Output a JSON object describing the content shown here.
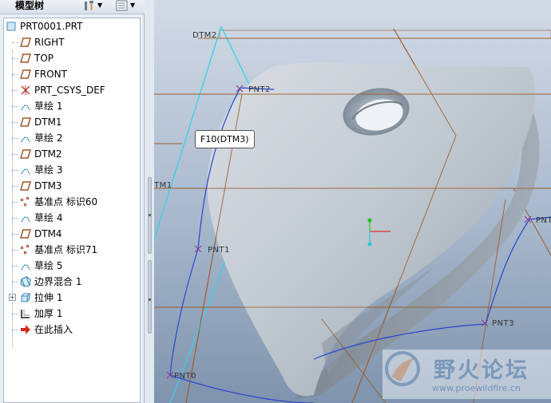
{
  "panel": {
    "title": "模型树"
  },
  "tree": {
    "root": "PRT0001.PRT",
    "items": [
      {
        "label": "RIGHT",
        "icon": "datum-plane-icon"
      },
      {
        "label": "TOP",
        "icon": "datum-plane-icon"
      },
      {
        "label": "FRONT",
        "icon": "datum-plane-icon"
      },
      {
        "label": "PRT_CSYS_DEF",
        "icon": "coordinate-system-icon"
      },
      {
        "label": "草绘 1",
        "icon": "sketch-icon"
      },
      {
        "label": "DTM1",
        "icon": "datum-plane-icon"
      },
      {
        "label": "草绘 2",
        "icon": "sketch-icon"
      },
      {
        "label": "DTM2",
        "icon": "datum-plane-icon"
      },
      {
        "label": "草绘 3",
        "icon": "sketch-icon"
      },
      {
        "label": "DTM3",
        "icon": "datum-plane-icon"
      },
      {
        "label": "基准点 标识60",
        "icon": "datum-point-icon"
      },
      {
        "label": "草绘 4",
        "icon": "sketch-icon"
      },
      {
        "label": "DTM4",
        "icon": "datum-plane-icon"
      },
      {
        "label": "基准点 标识71",
        "icon": "datum-point-icon"
      },
      {
        "label": "草绘 5",
        "icon": "sketch-icon"
      },
      {
        "label": "边界混合 1",
        "icon": "boundary-blend-icon"
      },
      {
        "label": "拉伸 1",
        "icon": "extrude-icon"
      },
      {
        "label": "加厚 1",
        "icon": "thicken-icon"
      },
      {
        "label": "在此插入",
        "icon": "insert-here-arrow-icon"
      }
    ]
  },
  "viewport": {
    "labels": {
      "dtm2": "DTM2",
      "dtm1": "TM1",
      "pnt2": "PNT2",
      "pnt1": "PNT1",
      "pnt3": "PNT3",
      "pnt0": "PNT0",
      "pnt_right": "PNT"
    },
    "tooltip": "F10(DTM3)"
  },
  "watermark": {
    "main": "野火论坛",
    "sub": "www.proewildfire.cn"
  },
  "colors": {
    "datum_plane": "#9a5a2a",
    "datum_curve": "#2a46d0",
    "dtm2_highlight": "#39d0e6",
    "part_surface": "#c3cbd3"
  }
}
